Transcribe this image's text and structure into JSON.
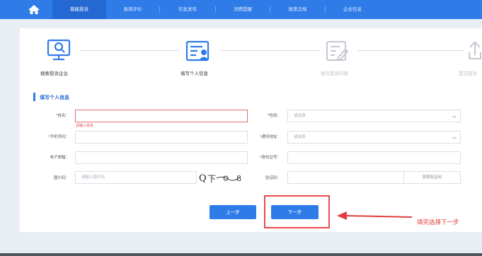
{
  "nav": {
    "items": [
      "我能投诉",
      "查询评价",
      "信息发布",
      "消费提醒",
      "政策法规",
      "企业信息"
    ],
    "active": 0
  },
  "steps": [
    {
      "label": "搜索投诉企业",
      "state": "done"
    },
    {
      "label": "填写个人信息",
      "state": "active"
    },
    {
      "label": "填写投诉内容",
      "state": "todo"
    },
    {
      "label": "提交投诉",
      "state": "todo"
    }
  ],
  "section_title": "填写个人信息",
  "form": {
    "name": {
      "label": "姓名：",
      "required": true,
      "value": "",
      "error": "请输入姓名"
    },
    "gender": {
      "label": "性别：",
      "required": true,
      "placeholder": "请选择"
    },
    "phone": {
      "label": "手机号码：",
      "required": true,
      "value": ""
    },
    "address": {
      "label": "通讯地址：",
      "required": true,
      "placeholder": "请选择"
    },
    "email": {
      "label": "电子邮箱：",
      "required": false,
      "value": ""
    },
    "idcard": {
      "label": "身份证号：",
      "required": true,
      "value": ""
    },
    "captcha": {
      "label": "图片码：",
      "placeholder": "请输入图片码"
    },
    "sms": {
      "label": "验证码：",
      "button": "获取验证码"
    }
  },
  "buttons": {
    "prev": "上一步",
    "next": "下一步"
  },
  "annotation": "填完选择下一步",
  "colors": {
    "primary": "#2f7ce8",
    "annotation": "#e23c3c"
  }
}
